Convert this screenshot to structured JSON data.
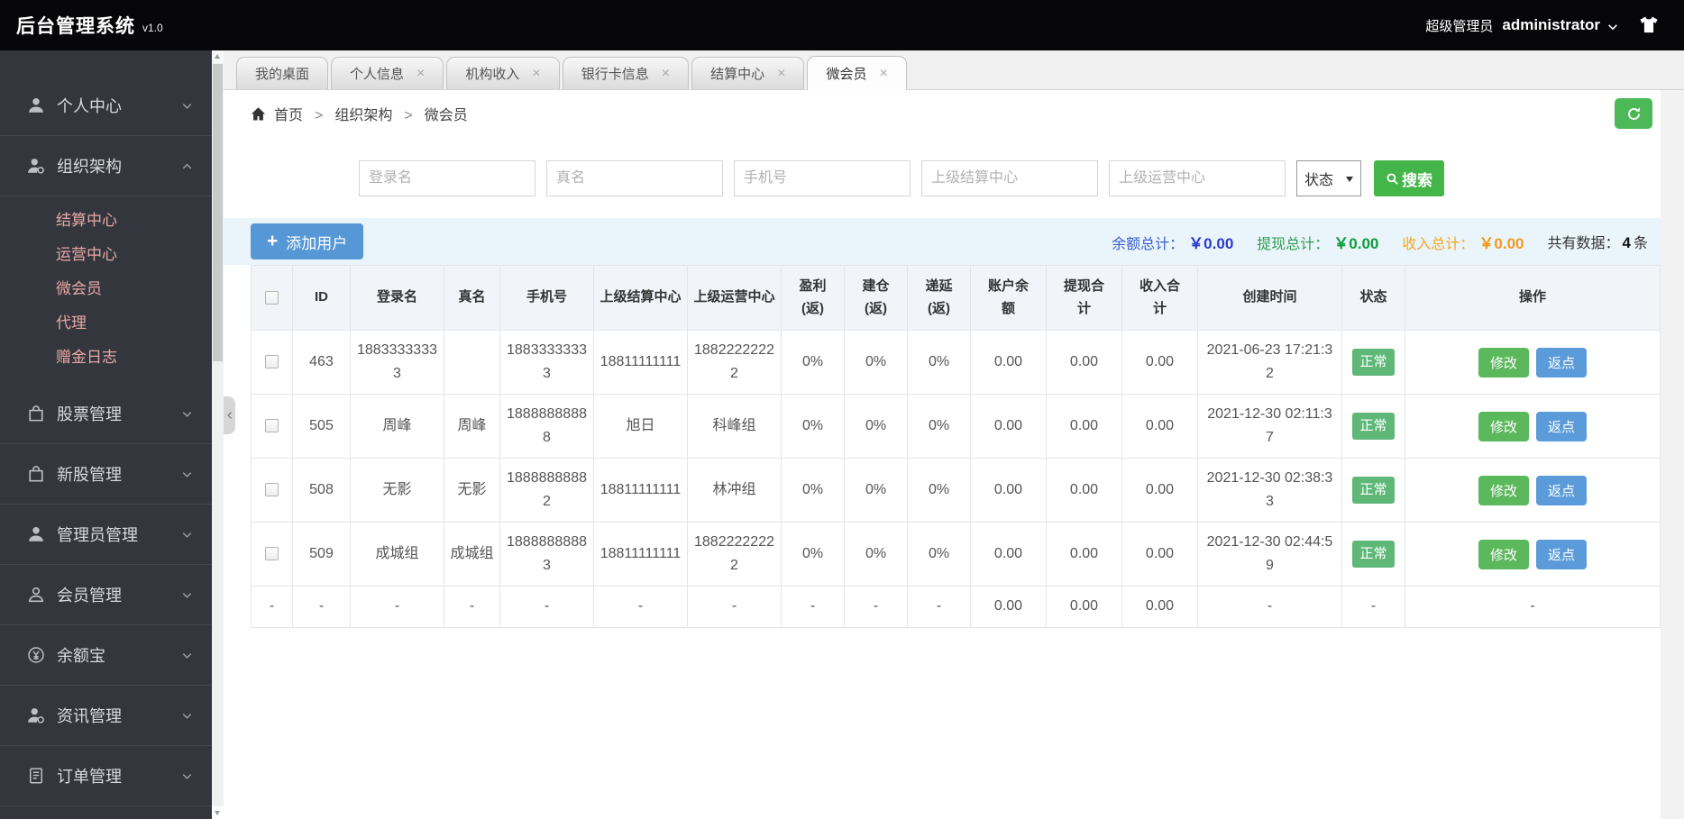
{
  "topbar": {
    "title": "后台管理系统",
    "version": "v1.0",
    "role": "超级管理员",
    "username": "administrator"
  },
  "sidebar": {
    "groups": [
      {
        "label": "个人中心",
        "icon": "user-icon",
        "expanded": false,
        "children": []
      },
      {
        "label": "组织架构",
        "icon": "org-icon",
        "expanded": true,
        "children": [
          "结算中心",
          "运营中心",
          "微会员",
          "代理",
          "赠金日志"
        ]
      },
      {
        "label": "股票管理",
        "icon": "stock-icon",
        "expanded": false,
        "children": []
      },
      {
        "label": "新股管理",
        "icon": "newstock-icon",
        "expanded": false,
        "children": []
      },
      {
        "label": "管理员管理",
        "icon": "admin-icon",
        "expanded": false,
        "children": []
      },
      {
        "label": "会员管理",
        "icon": "member-icon",
        "expanded": false,
        "children": []
      },
      {
        "label": "余额宝",
        "icon": "yuebao-icon",
        "expanded": false,
        "children": []
      },
      {
        "label": "资讯管理",
        "icon": "news-icon",
        "expanded": false,
        "children": []
      },
      {
        "label": "订单管理",
        "icon": "order-icon",
        "expanded": false,
        "children": []
      }
    ]
  },
  "tabs": [
    {
      "label": "我的桌面",
      "closable": false,
      "active": false
    },
    {
      "label": "个人信息",
      "closable": true,
      "active": false
    },
    {
      "label": "机构收入",
      "closable": true,
      "active": false
    },
    {
      "label": "银行卡信息",
      "closable": true,
      "active": false
    },
    {
      "label": "结算中心",
      "closable": true,
      "active": false
    },
    {
      "label": "微会员",
      "closable": true,
      "active": true
    }
  ],
  "breadcrumb": {
    "items": [
      "首页",
      "组织架构",
      "微会员"
    ],
    "separator": ">"
  },
  "filters": {
    "placeholders": [
      "登录名",
      "真名",
      "手机号",
      "上级结算中心",
      "上级运营中心"
    ],
    "status_label": "状态",
    "search_label": "搜索"
  },
  "toolbar": {
    "add_user_label": "添加用户",
    "stats": [
      {
        "label": "余额总计：",
        "value": "￥0.00",
        "color": "#3a5fd0",
        "value_color": "#2b3bcf"
      },
      {
        "label": "提现总计：",
        "value": "￥0.00",
        "color": "#2e9e4f",
        "value_color": "#0f9c3c"
      },
      {
        "label": "收入总计：",
        "value": "￥0.00",
        "color": "#f5a623",
        "value_color": "#f59a1b"
      }
    ],
    "count_label": "共有数据：",
    "count": "4",
    "count_unit": "条"
  },
  "table": {
    "headers": [
      "ID",
      "登录名",
      "真名",
      "手机号",
      "上级结算中心",
      "上级运营中心",
      "盈利\n(返)",
      "建仓\n(返)",
      "递延\n(返)",
      "账户余\n额",
      "提现合\n计",
      "收入合\n计",
      "创建时间",
      "状态",
      "操作"
    ],
    "action_labels": [
      "修改",
      "返点"
    ],
    "rows": [
      {
        "id": "463",
        "login": "18833333333",
        "real_name": "",
        "phone": "18833333333",
        "settle": "18811111111",
        "operate": "18822222222",
        "profit": "0%",
        "position": "0%",
        "defer": "0%",
        "balance": "0.00",
        "withdraw": "0.00",
        "income": "0.00",
        "created": "2021-06-23 17:21:32",
        "status": "正常"
      },
      {
        "id": "505",
        "login": "周峰",
        "real_name": "周峰",
        "phone": "18888888888",
        "settle": "旭日",
        "operate": "科峰组",
        "profit": "0%",
        "position": "0%",
        "defer": "0%",
        "balance": "0.00",
        "withdraw": "0.00",
        "income": "0.00",
        "created": "2021-12-30 02:11:37",
        "status": "正常"
      },
      {
        "id": "508",
        "login": "无影",
        "real_name": "无影",
        "phone": "18888888882",
        "settle": "18811111111",
        "operate": "林冲组",
        "profit": "0%",
        "position": "0%",
        "defer": "0%",
        "balance": "0.00",
        "withdraw": "0.00",
        "income": "0.00",
        "created": "2021-12-30 02:38:33",
        "status": "正常"
      },
      {
        "id": "509",
        "login": "成城组",
        "real_name": "成城组",
        "phone": "18888888883",
        "settle": "18811111111",
        "operate": "18822222222",
        "profit": "0%",
        "position": "0%",
        "defer": "0%",
        "balance": "0.00",
        "withdraw": "0.00",
        "income": "0.00",
        "created": "2021-12-30 02:44:59",
        "status": "正常"
      }
    ],
    "footer": {
      "checkbox": "-",
      "id": "-",
      "login": "-",
      "real_name": "-",
      "phone": "-",
      "settle": "-",
      "operate": "-",
      "profit": "-",
      "position": "-",
      "defer": "-",
      "balance": "0.00",
      "withdraw": "0.00",
      "income": "0.00",
      "created": "-",
      "status": "-",
      "actions": "-"
    }
  }
}
